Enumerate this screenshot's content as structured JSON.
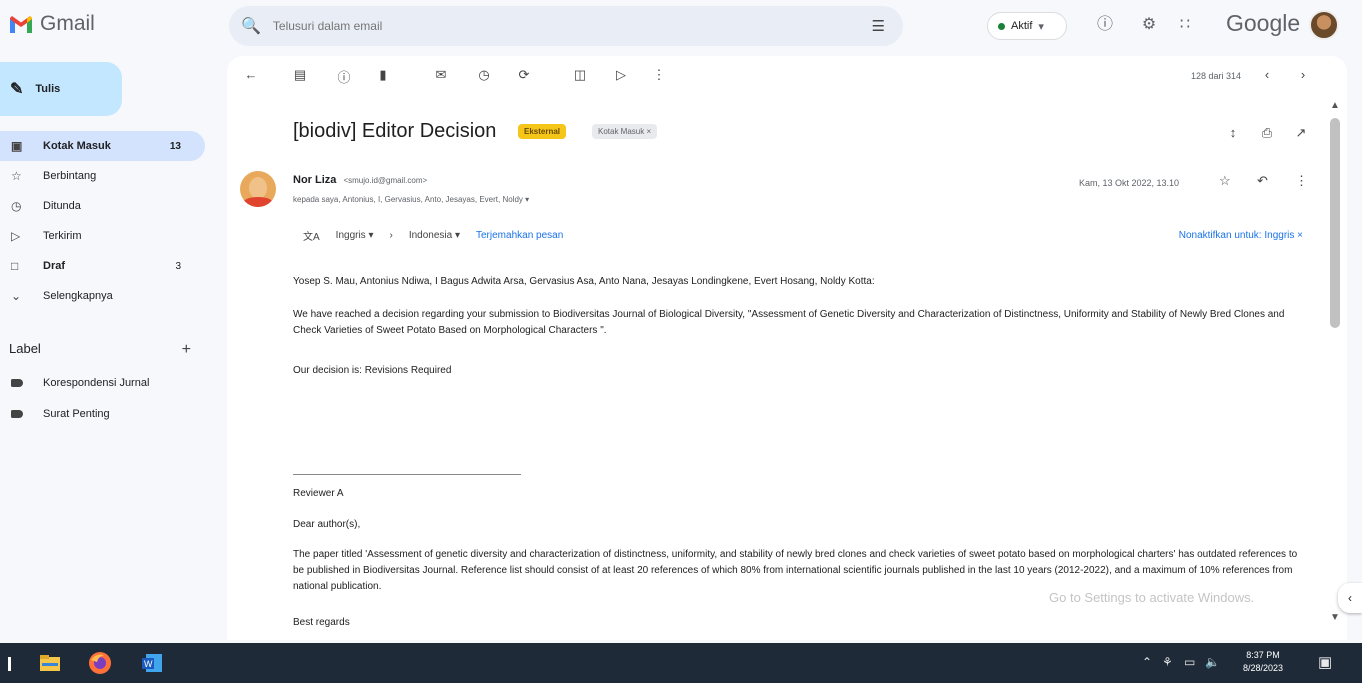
{
  "app": {
    "name": "Gmail",
    "brand": "Google"
  },
  "search": {
    "placeholder": "Telusuri dalam email"
  },
  "status": {
    "label": "Aktif"
  },
  "compose": {
    "label": "Tulis"
  },
  "nav": [
    {
      "label": "Kotak Masuk",
      "count": "13",
      "icon": "inbox-icon"
    },
    {
      "label": "Berbintang",
      "count": "",
      "icon": "star-icon"
    },
    {
      "label": "Ditunda",
      "count": "",
      "icon": "clock-icon"
    },
    {
      "label": "Terkirim",
      "count": "",
      "icon": "send-icon"
    },
    {
      "label": "Draf",
      "count": "3",
      "icon": "draft-icon"
    },
    {
      "label": "Selengkapnya",
      "count": "",
      "icon": "chevron-down-icon"
    }
  ],
  "labels": {
    "title": "Label",
    "items": [
      "Korespondensi Jurnal",
      "Surat Penting"
    ]
  },
  "pager": "128 dari 314",
  "email": {
    "subject": "[biodiv] Editor Decision",
    "badge_external": "Eksternal",
    "badge_inbox": "Kotak Masuk ×",
    "sender_name": "Nor Liza",
    "sender_email": "<smujo.id@gmail.com>",
    "recipients": "kepada saya, Antonius, I, Gervasius, Anto, Jesayas, Evert, Noldy ▾",
    "date": "Kam, 13 Okt 2022, 13.10",
    "translate_from": "Inggris ▾",
    "translate_to": "Indonesia ▾",
    "translate_link": "Terjemahkan pesan",
    "translate_off": "Nonaktifkan untuk: Inggris ×",
    "greeting": "Yosep S. Mau, Antonius Ndiwa, I Bagus Adwita Arsa, Gervasius Asa, Anto Nana, Jesayas Londingkene, Evert Hosang, Noldy Kotta:",
    "para1": "We have reached a decision regarding your submission to Biodiversitas Journal of Biological Diversity, \"Assessment of Genetic Diversity and Characterization of Distinctness, Uniformity and Stability of Newly Bred Clones and Check Varieties of Sweet Potato Based on Morphological Characters \".",
    "decision": "Our decision is: Revisions Required",
    "reviewer": "Reviewer A",
    "dear": "Dear author(s),",
    "para2": "The paper titled 'Assessment of genetic diversity and characterization of distinctness, uniformity, and stability of newly bred clones and check varieties of sweet potato based on morphological charters' has outdated references to be published in Biodiversitas Journal. Reference list should consist of at least 20 references of which 80% from international scientific journals published in the last 10 years (2012-2022), and a maximum of 10% references from national publication.",
    "regards": "Best regards"
  },
  "watermark": "Go to Settings to activate Windows.",
  "taskbar": {
    "time": "8:37 PM",
    "date": "8/28/2023"
  },
  "colors": {
    "compose_bg": "#c2e7ff",
    "active_nav": "#d3e3fd",
    "external_badge": "#f5c518",
    "taskbar": "#1f2a38"
  }
}
